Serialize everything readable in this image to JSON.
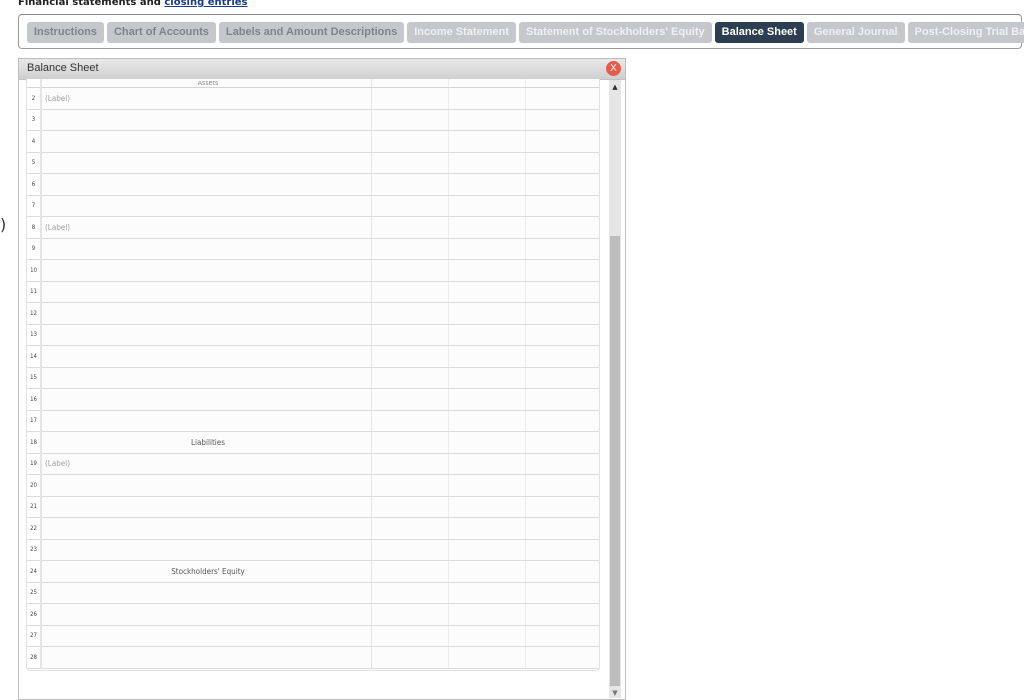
{
  "heading": {
    "prefix": "Financial statements and ",
    "link": "closing entries"
  },
  "tabs": [
    {
      "label": "Instructions",
      "state": "inactive"
    },
    {
      "label": "Chart of Accounts",
      "state": "inactive"
    },
    {
      "label": "Labels and Amount Descriptions",
      "state": "inactive"
    },
    {
      "label": "Income Statement",
      "state": "light"
    },
    {
      "label": "Statement of Stockholders' Equity",
      "state": "light"
    },
    {
      "label": "Balance Sheet",
      "state": "active"
    },
    {
      "label": "General Journal",
      "state": "light"
    },
    {
      "label": "Post-Closing Trial Balance",
      "state": "light"
    }
  ],
  "left_edge_glyph": ")",
  "panel": {
    "title": "Balance Sheet",
    "close_label": "X",
    "header_section": "Assets",
    "rows": [
      {
        "num": "2",
        "text": "(Label)",
        "kind": "placeholder"
      },
      {
        "num": "3",
        "text": "",
        "kind": "blank"
      },
      {
        "num": "4",
        "text": "",
        "kind": "blank"
      },
      {
        "num": "5",
        "text": "",
        "kind": "blank"
      },
      {
        "num": "6",
        "text": "",
        "kind": "blank"
      },
      {
        "num": "7",
        "text": "",
        "kind": "blank"
      },
      {
        "num": "8",
        "text": "(Label)",
        "kind": "placeholder"
      },
      {
        "num": "9",
        "text": "",
        "kind": "blank"
      },
      {
        "num": "10",
        "text": "",
        "kind": "blank"
      },
      {
        "num": "11",
        "text": "",
        "kind": "blank"
      },
      {
        "num": "12",
        "text": "",
        "kind": "blank"
      },
      {
        "num": "13",
        "text": "",
        "kind": "blank"
      },
      {
        "num": "14",
        "text": "",
        "kind": "blank"
      },
      {
        "num": "15",
        "text": "",
        "kind": "blank"
      },
      {
        "num": "16",
        "text": "",
        "kind": "blank"
      },
      {
        "num": "17",
        "text": "",
        "kind": "blank"
      },
      {
        "num": "18",
        "text": "Liabilities",
        "kind": "section"
      },
      {
        "num": "19",
        "text": "(Label)",
        "kind": "placeholder"
      },
      {
        "num": "20",
        "text": "",
        "kind": "blank"
      },
      {
        "num": "21",
        "text": "",
        "kind": "blank"
      },
      {
        "num": "22",
        "text": "",
        "kind": "blank"
      },
      {
        "num": "23",
        "text": "",
        "kind": "blank"
      },
      {
        "num": "24",
        "text": "Stockholders' Equity",
        "kind": "section"
      },
      {
        "num": "25",
        "text": "",
        "kind": "blank"
      },
      {
        "num": "26",
        "text": "",
        "kind": "blank"
      },
      {
        "num": "27",
        "text": "",
        "kind": "blank"
      },
      {
        "num": "28",
        "text": "",
        "kind": "blank"
      }
    ]
  },
  "scrollbar": {
    "up_icon": "▲",
    "down_icon": "▼"
  }
}
